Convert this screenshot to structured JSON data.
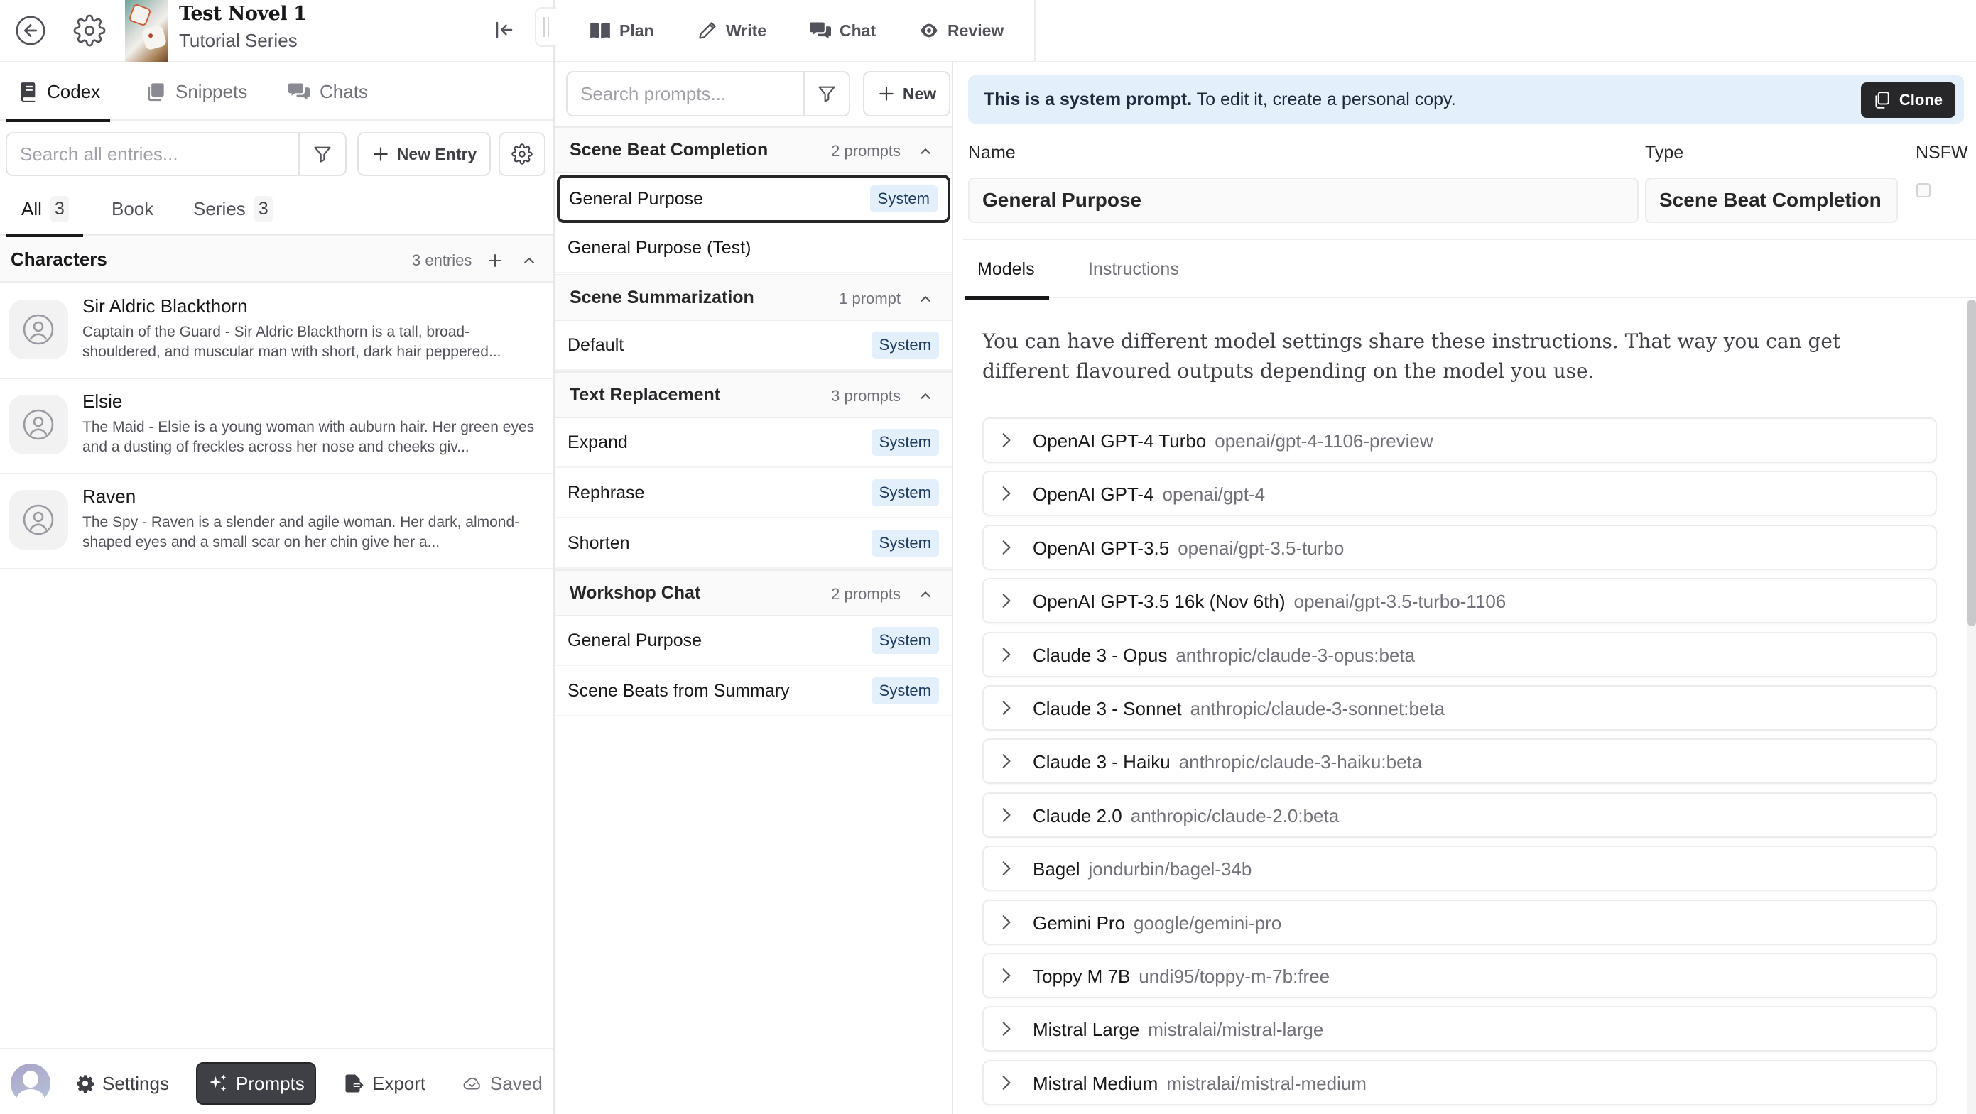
{
  "header": {
    "book_title": "Test Novel 1",
    "book_series": "Tutorial Series",
    "nav": [
      {
        "label": "Plan",
        "icon": "book-open-icon"
      },
      {
        "label": "Write",
        "icon": "pencil-icon"
      },
      {
        "label": "Chat",
        "icon": "chat-bubbles-icon"
      },
      {
        "label": "Review",
        "icon": "eye-icon"
      }
    ]
  },
  "left_panel": {
    "tabs": [
      {
        "label": "Codex",
        "active": true
      },
      {
        "label": "Snippets",
        "active": false
      },
      {
        "label": "Chats",
        "active": false
      }
    ],
    "search": {
      "placeholder": "Search all entries...",
      "value": ""
    },
    "new_entry_label": "New Entry",
    "scope_tabs": [
      {
        "label": "All",
        "count": "3",
        "active": true
      },
      {
        "label": "Book",
        "count": null,
        "active": false
      },
      {
        "label": "Series",
        "count": "3",
        "active": false
      }
    ],
    "section": {
      "title": "Characters",
      "count_label": "3 entries"
    },
    "characters": [
      {
        "name": "Sir Aldric Blackthorn",
        "description": "Captain of the Guard - Sir Aldric Blackthorn is a tall, broad-shouldered, and muscular man with short, dark hair peppered..."
      },
      {
        "name": "Elsie",
        "description": "The Maid - Elsie is a young woman with auburn hair. Her green eyes and a dusting of freckles across her nose and cheeks giv..."
      },
      {
        "name": "Raven",
        "description": "The Spy - Raven is a slender and agile woman. Her dark, almond-shaped eyes and a small scar on her chin give her a..."
      }
    ],
    "footer": {
      "settings_label": "Settings",
      "prompts_label": "Prompts",
      "export_label": "Export",
      "status_label": "Saved"
    }
  },
  "prompts_panel": {
    "search": {
      "placeholder": "Search prompts...",
      "value": ""
    },
    "new_label": "New",
    "groups": [
      {
        "title": "Scene Beat Completion",
        "count_label": "2 prompts",
        "items": [
          {
            "name": "General Purpose",
            "badge": "System",
            "selected": true
          },
          {
            "name": "General Purpose (Test)",
            "badge": null,
            "selected": false
          }
        ]
      },
      {
        "title": "Scene Summarization",
        "count_label": "1 prompt",
        "items": [
          {
            "name": "Default",
            "badge": "System",
            "selected": false
          }
        ]
      },
      {
        "title": "Text Replacement",
        "count_label": "3 prompts",
        "items": [
          {
            "name": "Expand",
            "badge": "System",
            "selected": false
          },
          {
            "name": "Rephrase",
            "badge": "System",
            "selected": false
          },
          {
            "name": "Shorten",
            "badge": "System",
            "selected": false
          }
        ]
      },
      {
        "title": "Workshop Chat",
        "count_label": "2 prompts",
        "items": [
          {
            "name": "General Purpose",
            "badge": "System",
            "selected": false
          },
          {
            "name": "Scene Beats from Summary",
            "badge": "System",
            "selected": false
          }
        ]
      }
    ]
  },
  "detail": {
    "banner": {
      "bold": "This is a system prompt.",
      "text": " To edit it, create a personal copy.",
      "clone_label": "Clone"
    },
    "fields": {
      "name_label": "Name",
      "name_value": "General Purpose",
      "type_label": "Type",
      "type_value": "Scene Beat Completion",
      "nsfw_label": "NSFW",
      "nsfw_checked": false
    },
    "tabs": [
      {
        "label": "Models",
        "active": true
      },
      {
        "label": "Instructions",
        "active": false
      }
    ],
    "intro": "You can have different model settings share these instructions. That way you can get different flavoured outputs depending on the model you use.",
    "models": [
      {
        "name": "OpenAI GPT-4 Turbo",
        "id": "openai/gpt-4-1106-preview"
      },
      {
        "name": "OpenAI GPT-4",
        "id": "openai/gpt-4"
      },
      {
        "name": "OpenAI GPT-3.5",
        "id": "openai/gpt-3.5-turbo"
      },
      {
        "name": "OpenAI GPT-3.5 16k (Nov 6th)",
        "id": "openai/gpt-3.5-turbo-1106"
      },
      {
        "name": "Claude 3 - Opus",
        "id": "anthropic/claude-3-opus:beta"
      },
      {
        "name": "Claude 3 - Sonnet",
        "id": "anthropic/claude-3-sonnet:beta"
      },
      {
        "name": "Claude 3 - Haiku",
        "id": "anthropic/claude-3-haiku:beta"
      },
      {
        "name": "Claude 2.0",
        "id": "anthropic/claude-2.0:beta"
      },
      {
        "name": "Bagel",
        "id": "jondurbin/bagel-34b"
      },
      {
        "name": "Gemini Pro",
        "id": "google/gemini-pro"
      },
      {
        "name": "Toppy M 7B",
        "id": "undi95/toppy-m-7b:free"
      },
      {
        "name": "Mistral Large",
        "id": "mistralai/mistral-large"
      },
      {
        "name": "Mistral Medium",
        "id": "mistralai/mistral-medium"
      }
    ]
  }
}
